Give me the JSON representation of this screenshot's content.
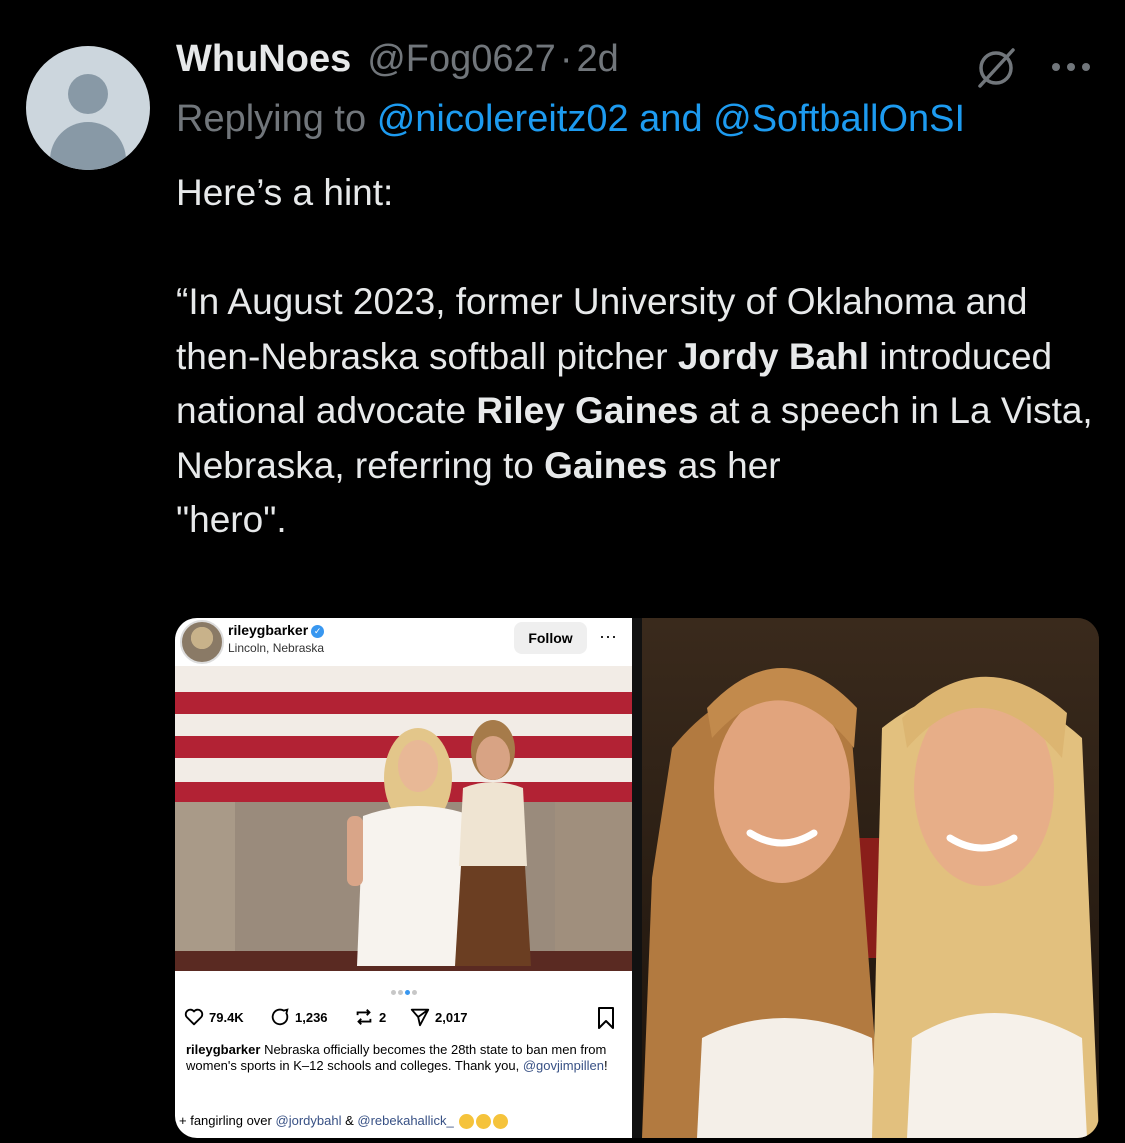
{
  "tweet": {
    "display_name": "WhuNoes",
    "handle": "@Fog0627",
    "separator": "·",
    "time": "2d",
    "replying_prefix": "Replying to",
    "replying_to_1": "@nicolereitz02",
    "replying_and": "and",
    "replying_to_2": "@SoftballOnSI",
    "text_line_1": "Here’s a hint:",
    "quote_open": "“In August 2023, former University of Oklahoma and then-Nebraska softball pitcher",
    "name_1": "Jordy Bahl",
    "mid_1": "introduced national advocate",
    "name_2": "Riley Gaines",
    "mid_2": "at a speech in La Vista, Nebraska, referring to",
    "name_3": "Gaines",
    "mid_3": "as her",
    "quote_end": "\"hero\"."
  },
  "icons": {
    "avatar": "default-avatar-icon",
    "grok": "grok-icon",
    "more": "more-options-icon"
  },
  "instagram": {
    "username": "rileygbarker",
    "location": "Lincoln, Nebraska",
    "follow_label": "Follow",
    "more_glyph": "···",
    "likes": "79.4K",
    "comments": "1,236",
    "reposts": "2",
    "shares": "2,017",
    "caption_user": "rileygbarker",
    "caption_text": "Nebraska officially becomes the 28th state to ban men from women's sports in K–12 schools and colleges. Thank you,",
    "caption_mention": "@govjimpillen",
    "caption_end": "!",
    "extra_prefix": "+ fangirling over",
    "extra_mention_1": "@jordybahl",
    "extra_and": "&",
    "extra_mention_2": "@rebekahallick_"
  },
  "colors": {
    "background": "#000000",
    "text": "#e7e9ea",
    "secondary": "#71767b",
    "link": "#1d9bf0"
  }
}
